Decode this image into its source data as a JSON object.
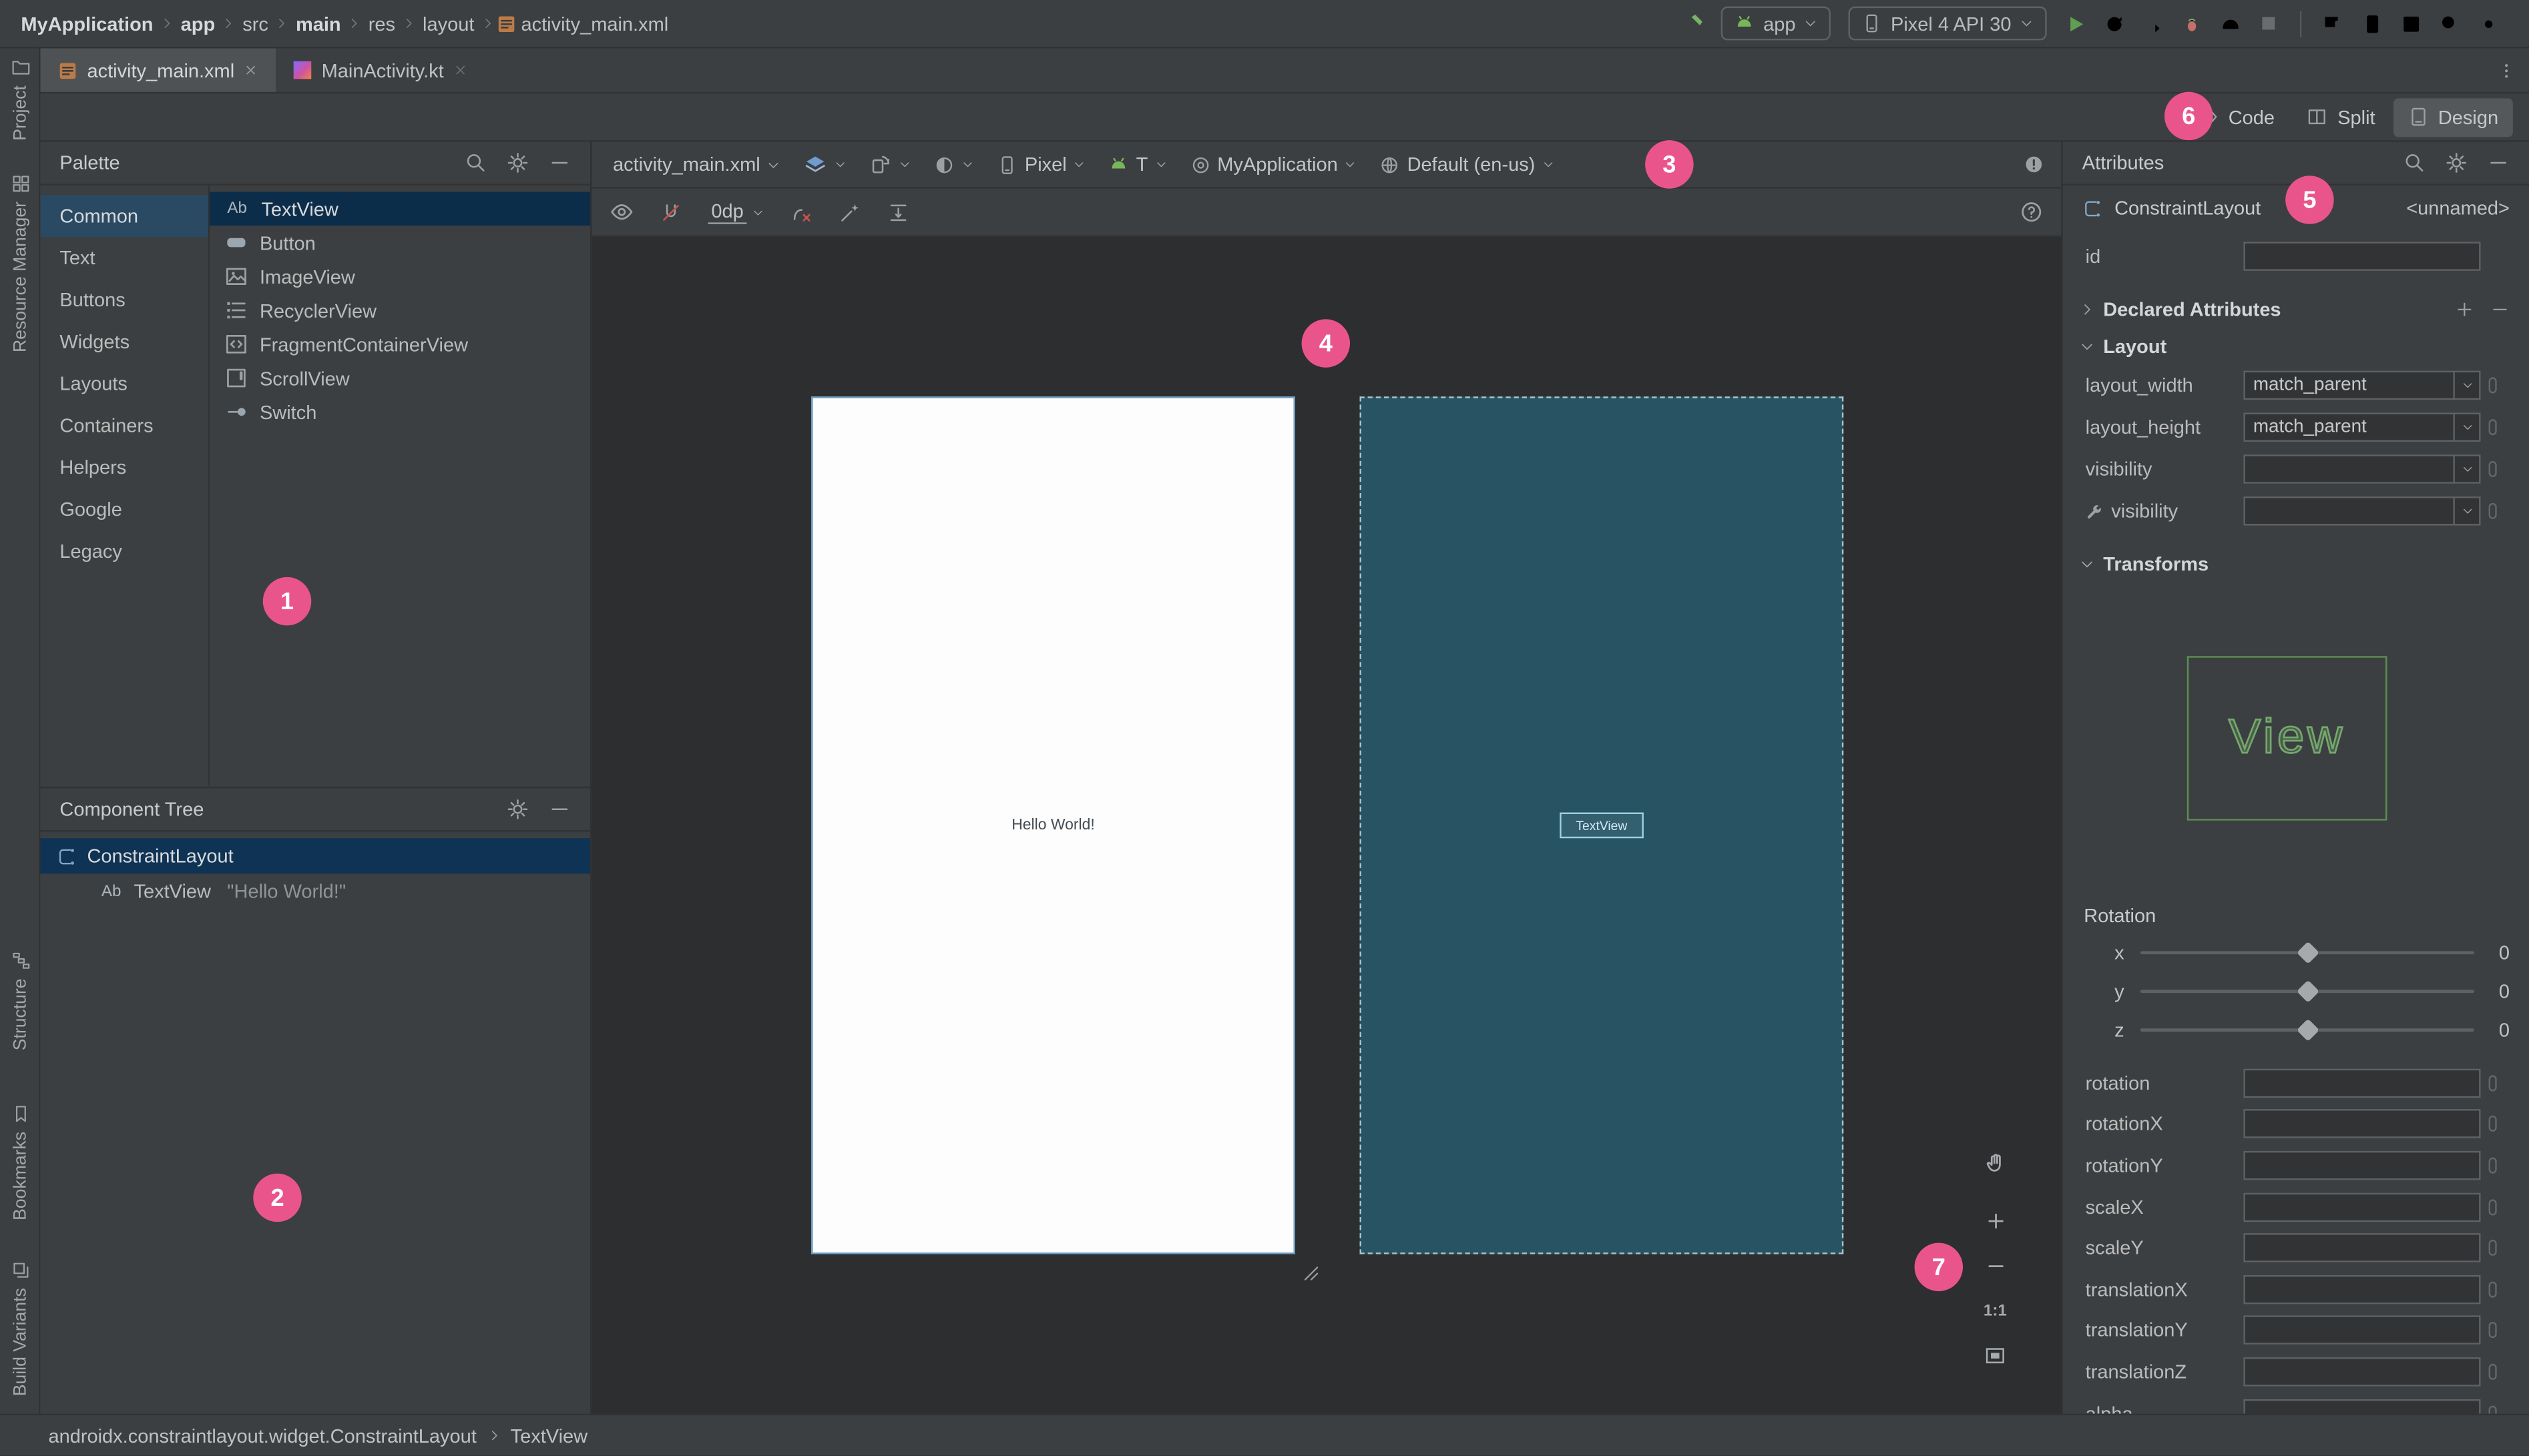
{
  "window": {
    "breadcrumbs": [
      "MyApplication",
      "app",
      "src",
      "main",
      "res",
      "layout",
      "activity_main.xml"
    ],
    "run_config": "app",
    "device": "Pixel 4 API 30"
  },
  "tabs": {
    "tab1": "activity_main.xml",
    "tab2": "MainActivity.kt"
  },
  "tool_stripes": {
    "project": "Project",
    "resource_manager": "Resource Manager",
    "structure": "Structure",
    "bookmarks": "Bookmarks",
    "build_variants": "Build Variants"
  },
  "view_modes": {
    "code": "Code",
    "split": "Split",
    "design": "Design"
  },
  "palette": {
    "title": "Palette",
    "categories": [
      {
        "label": "Common"
      },
      {
        "label": "Text"
      },
      {
        "label": "Buttons"
      },
      {
        "label": "Widgets"
      },
      {
        "label": "Layouts"
      },
      {
        "label": "Containers"
      },
      {
        "label": "Helpers"
      },
      {
        "label": "Google"
      },
      {
        "label": "Legacy"
      }
    ],
    "components": [
      {
        "label": "TextView",
        "icon_glyph": "Ab"
      },
      {
        "label": "Button"
      },
      {
        "label": "ImageView"
      },
      {
        "label": "RecyclerView"
      },
      {
        "label": "FragmentContainerView"
      },
      {
        "label": "ScrollView"
      },
      {
        "label": "Switch"
      }
    ]
  },
  "component_tree": {
    "title": "Component Tree",
    "root": "ConstraintLayout",
    "child": "TextView",
    "child_icon_glyph": "Ab",
    "child_detail": "\"Hello World!\""
  },
  "design_toolbar": {
    "file": "activity_main.xml",
    "device": "Pixel",
    "api": "T",
    "theme": "MyApplication",
    "locale": "Default (en-us)",
    "margin": "0dp"
  },
  "canvas": {
    "hello": "Hello World!",
    "blueprint_widget": "TextView",
    "zoom_one_to_one": "1:1"
  },
  "attributes": {
    "title": "Attributes",
    "component": "ConstraintLayout",
    "component_id": "<unnamed>",
    "id_label": "id",
    "id_value": "",
    "declared_attributes": "Declared Attributes",
    "layout_section": "Layout",
    "rows": {
      "layout_width": {
        "label": "layout_width",
        "value": "match_parent"
      },
      "layout_height": {
        "label": "layout_height",
        "value": "match_parent"
      },
      "visibility": {
        "label": "visibility",
        "value": ""
      },
      "tools_visibility": {
        "label": "visibility",
        "value": ""
      }
    },
    "transforms_section": "Transforms",
    "view_preview": "View",
    "rotation_label": "Rotation",
    "sliders": [
      {
        "axis": "x",
        "value": "0"
      },
      {
        "axis": "y",
        "value": "0"
      },
      {
        "axis": "z",
        "value": "0"
      }
    ],
    "fields": [
      {
        "label": "rotation"
      },
      {
        "label": "rotationX"
      },
      {
        "label": "rotationY"
      },
      {
        "label": "scaleX"
      },
      {
        "label": "scaleY"
      },
      {
        "label": "translationX"
      },
      {
        "label": "translationY"
      },
      {
        "label": "translationZ"
      },
      {
        "label": "alpha"
      }
    ]
  },
  "status_bar": {
    "path": "androidx.constraintlayout.widget.ConstraintLayout",
    "selected": "TextView"
  },
  "annotations": {
    "badges": [
      "1",
      "2",
      "3",
      "4",
      "5",
      "6",
      "7"
    ]
  }
}
